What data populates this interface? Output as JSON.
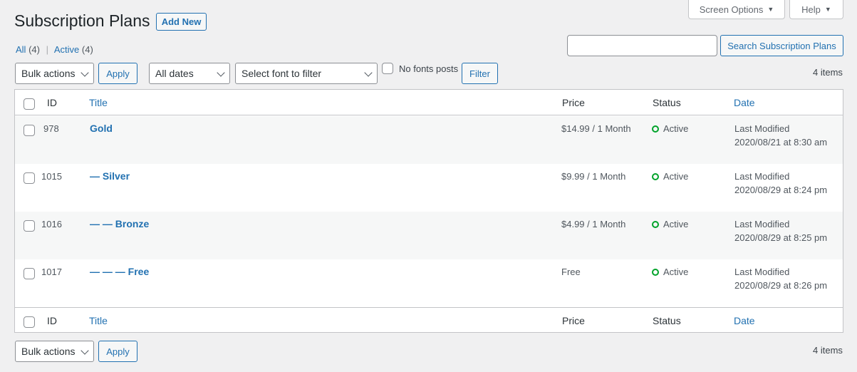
{
  "header": {
    "screen_options": "Screen Options",
    "help": "Help",
    "title": "Subscription Plans",
    "add_new": "Add New"
  },
  "views": {
    "all_label": "All",
    "all_count": "(4)",
    "separator": "|",
    "active_label": "Active",
    "active_count": "(4)"
  },
  "search": {
    "value": "",
    "button": "Search Subscription Plans"
  },
  "filters": {
    "bulk_actions": "Bulk actions",
    "apply": "Apply",
    "dates": "All dates",
    "font_filter": "Select font to filter",
    "no_fonts_label": "No fonts posts",
    "filter_button": "Filter",
    "items_count": "4 items"
  },
  "table": {
    "columns": {
      "id": "ID",
      "title": "Title",
      "price": "Price",
      "status": "Status",
      "date": "Date"
    },
    "rows": [
      {
        "id": "978",
        "title": "Gold",
        "price": "$14.99 / 1 Month",
        "status": "Active",
        "date_label": "Last Modified",
        "date": "2020/08/21 at 8:30 am"
      },
      {
        "id": "1015",
        "title": "— Silver",
        "price": "$9.99 / 1 Month",
        "status": "Active",
        "date_label": "Last Modified",
        "date": "2020/08/29 at 8:24 pm"
      },
      {
        "id": "1016",
        "title": "— — Bronze",
        "price": "$4.99 / 1 Month",
        "status": "Active",
        "date_label": "Last Modified",
        "date": "2020/08/29 at 8:25 pm"
      },
      {
        "id": "1017",
        "title": "— — — Free",
        "price": "Free",
        "status": "Active",
        "date_label": "Last Modified",
        "date": "2020/08/29 at 8:26 pm"
      }
    ]
  },
  "bottom": {
    "bulk_actions": "Bulk actions",
    "apply": "Apply",
    "items_count": "4 items"
  },
  "colors": {
    "accent": "#2271b1",
    "status_active": "#00a32a",
    "background": "#f0f0f1"
  }
}
